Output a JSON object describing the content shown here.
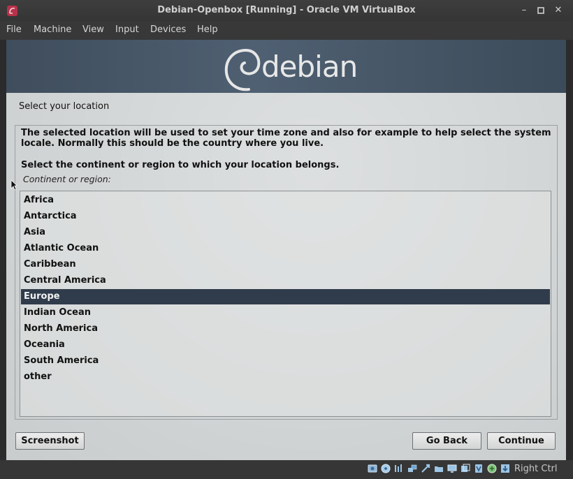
{
  "window": {
    "title": "Debian-Openbox [Running] - Oracle VM VirtualBox",
    "minimize_icon": "minimize-icon",
    "maximize_icon": "maximize-icon",
    "close_icon": "close-icon"
  },
  "menu": [
    "File",
    "Machine",
    "View",
    "Input",
    "Devices",
    "Help"
  ],
  "banner": {
    "logo_text": "debian"
  },
  "installer": {
    "heading": "Select your location",
    "description": "The selected location will be used to set your time zone and also for example to help select the system locale. Normally this should be the country where you live.",
    "prompt": "Select the continent or region to which your location belongs.",
    "field_label": "Continent or region:",
    "options": [
      "Africa",
      "Antarctica",
      "Asia",
      "Atlantic Ocean",
      "Caribbean",
      "Central America",
      "Europe",
      "Indian Ocean",
      "North America",
      "Oceania",
      "South America",
      "other"
    ],
    "selected": "Europe",
    "buttons": {
      "screenshot": "Screenshot",
      "go_back": "Go Back",
      "continue": "Continue"
    }
  },
  "statusbar": {
    "indicators": [
      "hard-disk-icon",
      "optical-drive-icon",
      "audio-icon",
      "network-icon",
      "usb-icon",
      "shared-folders-icon",
      "display-icon",
      "video-capture-icon",
      "recording-icon",
      "mouse-integration-icon",
      "keyboard-capture-icon"
    ],
    "host_key": "Right Ctrl"
  },
  "colors": {
    "selection": "#303c4b",
    "panel": "#e0e2e2",
    "chrome": "#383838"
  }
}
